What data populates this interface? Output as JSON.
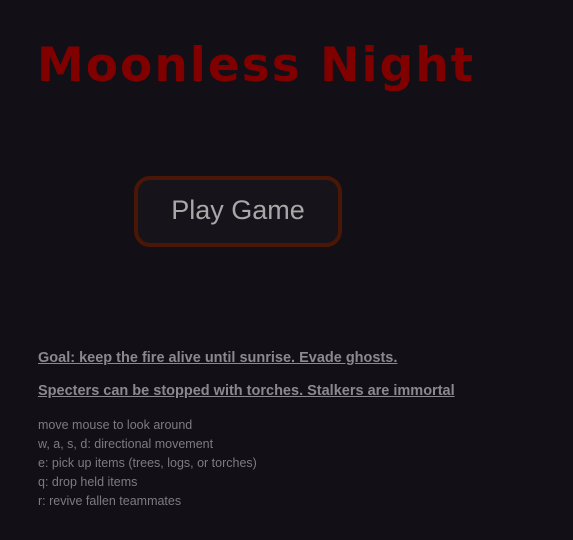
{
  "title": "Moonless Night",
  "play_button_label": "Play Game",
  "goals": [
    "Goal: keep the fire alive until sunrise. Evade ghosts.",
    "Specters can be stopped with torches. Stalkers are immortal"
  ],
  "controls": [
    "move mouse to look around",
    "w, a, s, d: directional movement",
    "e: pick up items (trees, logs, or torches)",
    "q: drop held items",
    "r: revive fallen teammates"
  ],
  "colors": {
    "background": "#120f16",
    "title": "#800000",
    "button_border": "#4a1707",
    "text": "#8a8a8e"
  }
}
